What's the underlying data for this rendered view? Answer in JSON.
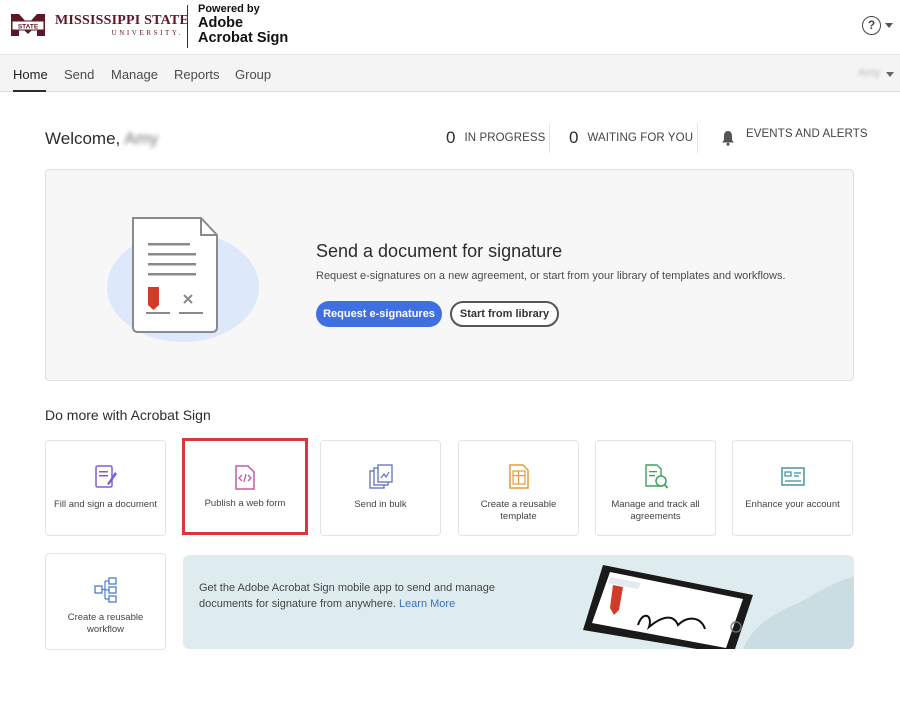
{
  "header": {
    "university_line1": "MISSISSIPPI STATE",
    "university_line2": "UNIVERSITY.",
    "logo_badge": "STATE",
    "powered_by": "Powered by",
    "product_line1": "Adobe",
    "product_line2": "Acrobat Sign",
    "help_glyph": "?"
  },
  "nav": {
    "items": [
      "Home",
      "Send",
      "Manage",
      "Reports",
      "Group"
    ],
    "active": "Home",
    "user": "Amy"
  },
  "welcome": {
    "greeting": "Welcome,",
    "name": "Amy"
  },
  "stats": [
    {
      "count": "0",
      "label": "IN PROGRESS"
    },
    {
      "count": "0",
      "label": "WAITING FOR YOU"
    }
  ],
  "events_label": "EVENTS AND ALERTS",
  "hero": {
    "title": "Send a document for signature",
    "description": "Request e-signatures on a new agreement, or start from your library of templates and workflows.",
    "primary_button": "Request e-signatures",
    "secondary_button": "Start from library"
  },
  "do_more": {
    "title": "Do more with Acrobat Sign",
    "cards": [
      {
        "label": "Fill and sign a document",
        "icon": "fill-sign-icon"
      },
      {
        "label": "Publish a web form",
        "icon": "web-form-icon"
      },
      {
        "label": "Send in bulk",
        "icon": "send-bulk-icon"
      },
      {
        "label": "Create a reusable template",
        "icon": "template-icon"
      },
      {
        "label": "Manage and track all agreements",
        "icon": "manage-track-icon"
      },
      {
        "label": "Enhance your account",
        "icon": "enhance-account-icon"
      },
      {
        "label": "Create a reusable workflow",
        "icon": "workflow-icon"
      }
    ]
  },
  "promo": {
    "text": "Get the Adobe Acrobat Sign mobile app to send and manage documents for signature from anywhere.",
    "link": "Learn More"
  },
  "colors": {
    "brand_maroon": "#5d1725",
    "primary_button": "#3f6fe0",
    "highlight_border": "#d9373b",
    "promo_bg": "#dfecef",
    "signature_red": "#d03b2a"
  }
}
